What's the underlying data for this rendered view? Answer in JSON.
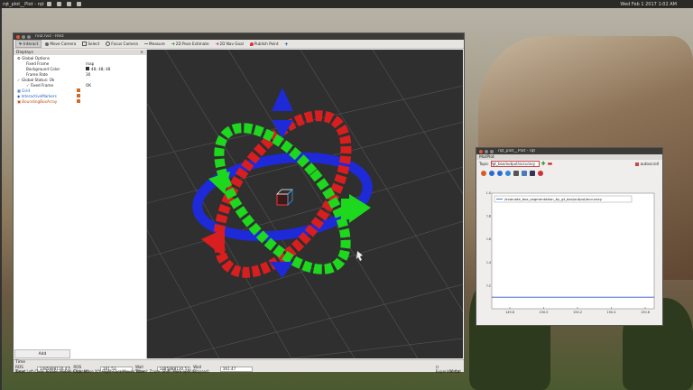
{
  "top_panel": {
    "title": "rqt_plot__Plot - rqt",
    "clock": "Wed Feb 1 2017  1:02 AM"
  },
  "rviz": {
    "title": "rviz.rviz - RViz",
    "toolbar": [
      {
        "label": "Interact",
        "icon": "cursor-icon",
        "active": true
      },
      {
        "label": "Move Camera",
        "icon": "move-camera-icon"
      },
      {
        "label": "Select",
        "icon": "select-icon"
      },
      {
        "label": "Focus Camera",
        "icon": "focus-camera-icon"
      },
      {
        "label": "Measure",
        "icon": "measure-icon"
      },
      {
        "label": "2D Pose Estimate",
        "icon": "pose-estimate-icon"
      },
      {
        "label": "2D Nav Goal",
        "icon": "nav-goal-icon"
      },
      {
        "label": "Publish Point",
        "icon": "publish-point-icon"
      }
    ],
    "displays": {
      "header": "Displays",
      "rows": [
        {
          "key": "Global Options",
          "value": "",
          "indent": 1
        },
        {
          "key": "Fixed Frame",
          "value": "map",
          "indent": 2
        },
        {
          "key": "Background Color",
          "value": "48; 48; 48",
          "indent": 2,
          "swatch": "#303030"
        },
        {
          "key": "Frame Rate",
          "value": "30",
          "indent": 2
        },
        {
          "key": "Global Status: Ok",
          "value": "",
          "indent": 1
        },
        {
          "key": "Fixed Frame",
          "value": "OK",
          "indent": 2
        },
        {
          "key": "Grid",
          "value": "",
          "indent": 1,
          "link": true,
          "swatch": "#d46a2a"
        },
        {
          "key": "InteractiveMarkers",
          "value": "",
          "indent": 1,
          "link": true,
          "swatch": "#d46a2a"
        },
        {
          "key": "BoundingBoxArray",
          "value": "",
          "indent": 1,
          "link": true,
          "swatch": "#d46a2a"
        }
      ],
      "add_label": "Add"
    },
    "time": {
      "header": "Time",
      "ros_time_label": "ROS Time:",
      "ros_time": "1485888130.47",
      "ros_elapsed_label": "ROS Elapsed:",
      "ros_elapsed": "161.53",
      "wall_time_label": "Wall Time:",
      "wall_time": "1485888130.51",
      "wall_elapsed_label": "Wall Elapsed:",
      "wall_elapsed": "161.47",
      "experimental_label": "Experimental",
      "fps": "30 fps",
      "reset_label": "Reset",
      "hint": "Left-Click: Rotate.  Middle-Click: Move X/Y.  Right-Click/Mouse Wheel: Zoom.  Shift: More options."
    }
  },
  "plot": {
    "title": "rqt_plot__Plot - rqt",
    "subtitle": "MatPlot",
    "topic_label": "Topic",
    "topic_value": "/gt_box/output/accuracy",
    "autoscroll_label": "autoscroll",
    "chart_data": {
      "type": "line",
      "series": [
        {
          "name": "/evaluate_box_segmentation_by_gt_box/output/accuracy",
          "x": [
            145,
            158
          ],
          "y": [
            0.1,
            0.1
          ],
          "color": "#3355cc"
        }
      ],
      "xlim": [
        145,
        158
      ],
      "ylim": [
        0,
        1.0
      ],
      "x_ticks": [
        "149.8",
        "150.0",
        "150.2",
        "150.4",
        "150.6"
      ],
      "y_ticks": [
        "1.0",
        "0.8",
        "0.6",
        "0.4",
        "0.2"
      ],
      "legend": "top"
    }
  }
}
